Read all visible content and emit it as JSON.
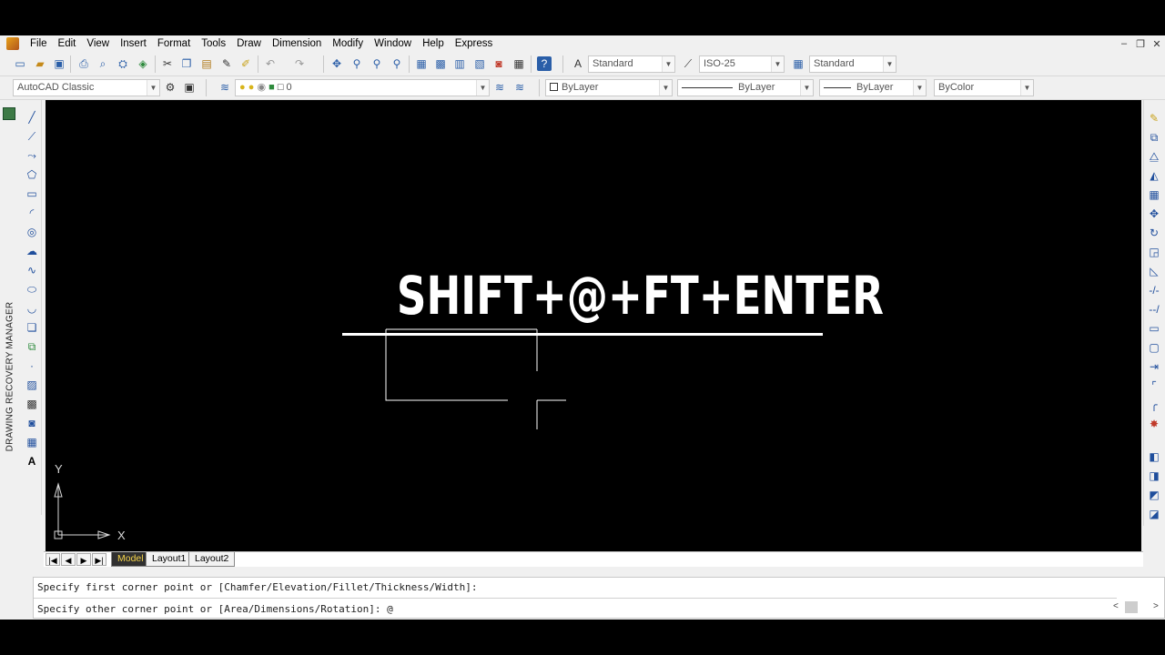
{
  "menu": {
    "items": [
      "File",
      "Edit",
      "View",
      "Insert",
      "Format",
      "Tools",
      "Draw",
      "Dimension",
      "Modify",
      "Window",
      "Help",
      "Express"
    ],
    "window_controls": [
      "–",
      "❐",
      "✕"
    ]
  },
  "toolbar_standard": {
    "text_style": "Standard",
    "dim_style": "ISO-25",
    "table_style": "Standard"
  },
  "toolbar_layers": {
    "workspace": "AutoCAD Classic",
    "layer": "0",
    "color": "ByLayer",
    "linetype": "ByLayer",
    "lineweight": "ByLayer",
    "plot_style": "ByColor"
  },
  "left_panel": {
    "label": "DRAWING RECOVERY MANAGER"
  },
  "canvas": {
    "caption": "SHIFT+@+FT+ENTER",
    "ucs_x": "X",
    "ucs_y": "Y",
    "background": "#000000",
    "line_color": "#ffffff"
  },
  "layout_tabs": {
    "nav": [
      "|◀",
      "◀",
      "▶",
      "▶|"
    ],
    "tabs": [
      "Model",
      "Layout1",
      "Layout2"
    ],
    "active": "Model"
  },
  "command_line": {
    "history": "Specify first corner point or [Chamfer/Elevation/Fillet/Thickness/Width]:",
    "current": "Specify other corner point or [Area/Dimensions/Rotation]: @"
  }
}
